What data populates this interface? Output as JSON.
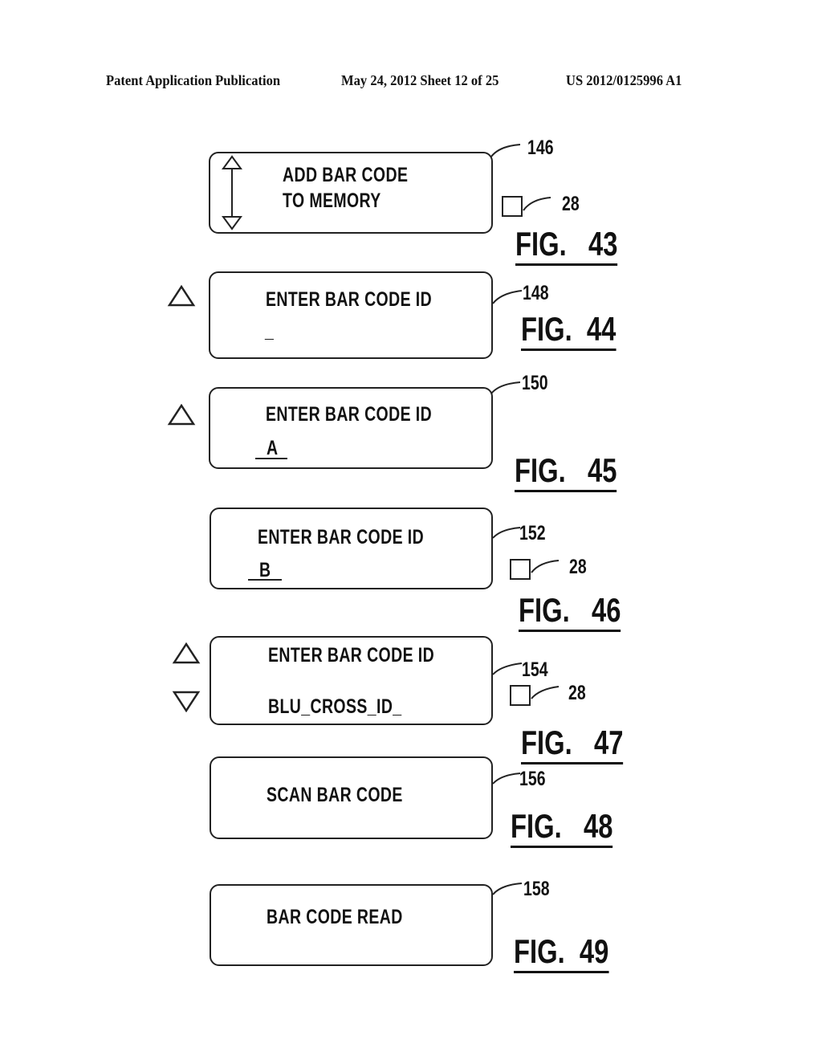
{
  "header": {
    "left": "Patent Application Publication",
    "center": "May 24, 2012  Sheet 12 of 25",
    "right": "US 2012/0125996 A1"
  },
  "figures": [
    {
      "fig_label": "FIG.   43",
      "ref": "146",
      "lines": [
        "ADD BAR CODE",
        "TO MEMORY"
      ],
      "indicator_ref": "28",
      "icons": [
        "up-down-arrow"
      ]
    },
    {
      "fig_label": "FIG.  44",
      "ref": "148",
      "lines": [
        "ENTER BAR CODE ID",
        "_"
      ],
      "icons": [
        "up-triangle"
      ]
    },
    {
      "fig_label": "FIG.   45",
      "ref": "150",
      "lines": [
        "ENTER BAR CODE ID",
        "A"
      ],
      "icons": [
        "up-triangle"
      ]
    },
    {
      "fig_label": "FIG.   46",
      "ref": "152",
      "lines": [
        "ENTER BAR CODE ID",
        "B"
      ],
      "indicator_ref": "28",
      "icons": []
    },
    {
      "fig_label": "FIG.   47",
      "ref": "154",
      "lines": [
        "ENTER BAR CODE ID",
        "BLU_CROSS_ID_"
      ],
      "indicator_ref": "28",
      "icons": [
        "up-triangle",
        "down-triangle"
      ]
    },
    {
      "fig_label": "FIG.   48",
      "ref": "156",
      "lines": [
        "SCAN BAR CODE"
      ],
      "icons": []
    },
    {
      "fig_label": "FIG.  49",
      "ref": "158",
      "lines": [
        "BAR CODE READ"
      ],
      "icons": []
    }
  ]
}
